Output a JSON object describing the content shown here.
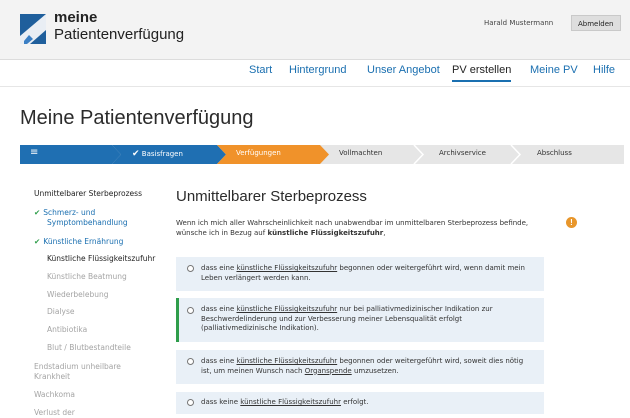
{
  "brand": {
    "line1": "meine",
    "line2": "Patientenverfügung"
  },
  "user": {
    "name": "Harald Mustermann",
    "logout_label": "Abmelden"
  },
  "nav": {
    "items": [
      "Start",
      "Hintergrund",
      "Unser Angebot",
      "PV erstellen",
      "Meine PV",
      "Hilfe"
    ],
    "active": "PV erstellen"
  },
  "page": {
    "title": "Meine Patientenverfügung"
  },
  "steps": {
    "menu_icon": "≡",
    "items": [
      "Basisfragen",
      "Verfügungen",
      "Vollmachten",
      "Archivservice",
      "Abschluss"
    ],
    "completed": [
      "Basisfragen"
    ],
    "active": "Verfügungen",
    "colors": {
      "done": "#1f6fb2",
      "active": "#f0922a",
      "pending": "#e6e6e6"
    }
  },
  "sidebar": {
    "section1": "Unmittelbarer Sterbeprozess",
    "done1_line1": "Schmerz- und",
    "done1_line2": "Symptombehandlung",
    "done2": "Künstliche Ernährung",
    "current": "Künstliche Flüssigkeitszufuhr",
    "upcoming": [
      "Künstliche Beatmung",
      "Wiederbelebung",
      "Dialyse",
      "Antibiotika",
      "Blut / Blutbestandteile"
    ],
    "section2_line1": "Endstadium unheilbare",
    "section2_line2": "Krankheit",
    "section3": "Wachkoma",
    "section4": "Verlust der"
  },
  "content": {
    "title": "Unmittelbarer Sterbeprozess",
    "intro_part1": "Wenn ich mich aller Wahrscheinlichkeit nach unabwendbar im unmittelbaren Sterbeprozess befinde, wünsche ich in Bezug auf ",
    "intro_bold": "künstliche Flüssigkeitszufuhr",
    "intro_part2": ",",
    "info_icon": "!"
  },
  "options": {
    "o1": {
      "pre": "dass eine ",
      "link": "künstliche Flüssigkeitszufuhr",
      "post": " begonnen oder weitergeführt wird, wenn damit mein Leben verlängert werden kann."
    },
    "o2": {
      "pre": "dass eine ",
      "link": "künstliche Flüssigkeitszufuhr",
      "post": " nur bei palliativmedizinischer Indikation zur Beschwerdelinderung und zur Verbesserung meiner Lebensqualität erfolgt (palliativmedizinische Indikation)."
    },
    "o3": {
      "pre": "dass eine ",
      "link": "künstliche Flüssigkeitszufuhr",
      "mid": " begonnen oder weitergeführt wird, soweit dies nötig ist, um meinen Wunsch nach ",
      "link2": "Organspende",
      "post": " umzusetzen."
    },
    "o4": {
      "pre": "dass keine ",
      "link": "künstliche Flüssigkeitszufuhr",
      "post": " erfolgt."
    },
    "selected": "o2"
  }
}
